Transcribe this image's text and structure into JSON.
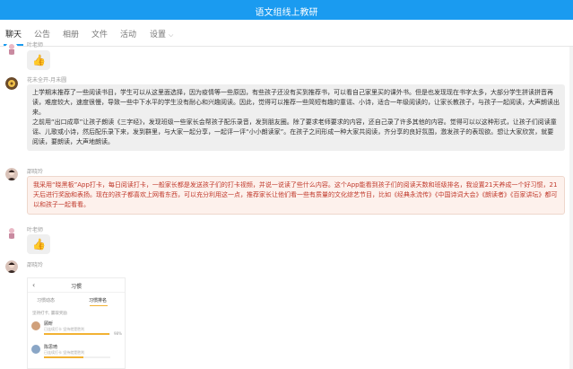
{
  "window": {
    "title": "语文组线上教研"
  },
  "tabs": [
    {
      "label": "聊天"
    },
    {
      "label": "公告"
    },
    {
      "label": "相册"
    },
    {
      "label": "文件"
    },
    {
      "label": "活动"
    },
    {
      "label": "设置"
    }
  ],
  "messages": [
    {
      "sender": "叶老师",
      "type": "emoji",
      "emoji": "👍"
    },
    {
      "sender": "花未全开-月未圆",
      "type": "text",
      "lines": [
        "上学期末推荐了一些阅读书目，学生可以从这里面选择，因为疫情等一些原因，有些孩子还没有买到推荐书，可以看自己家里买的课外书。但是也发现现在书字太多，大部分学生拼读拼音再读，难度较大，速度很慢，导致一些中下水平的学生没有耐心和兴趣阅读。因此，觉得可以推荐一些简短有趣的童谣、小诗，适合一年级阅读的，让家长教孩子，与孩子一起阅读，大声朗读出来。",
        "之前用“出口成章”让孩子朗读《三字经》，发现班级一些家长会帮孩子配乐录音，发到朋友圈。除了要求老师要求的内容，还自己录了许多其他的内容。觉得可以以这种形式，让孩子们阅读童谣、儿歌或小诗，然后配乐录下来，发到群里，与大家一起分享，一起评一评“小小朗读家”。在孩子之间形成一种大家共阅读，齐分享的良好氛围，激发孩子的表现欲。想让大家欣赏，就要阅读，要朗读，大声地朗读。"
      ]
    },
    {
      "sender": "邵晓玲",
      "type": "text",
      "lines": [
        "我采用“晓黑板”App打卡，每日阅读打卡，一般家长都是发送孩子们的打卡视频，并说一说读了些什么内容。这个App能看到孩子们的阅读天数和班级排名，我设置21天养成一个好习惯，21天后进行奖励和表扬。现在的孩子都喜欢上网看东西，可以充分利用这一点，推荐家长让他们看一些有质量的文化综艺节目，比如《经典永流传》《中国诗词大会》《朗读者》《百家讲坛》都可以和孩子一起看看。"
      ]
    },
    {
      "sender": "叶老师",
      "type": "emoji",
      "emoji": "👍"
    },
    {
      "sender": "邵晓玲",
      "type": "image",
      "phone": {
        "back": "‹",
        "title": "习惯",
        "tabs": [
          "习惯动态",
          "习惯排名"
        ],
        "tip": "坚持打卡, 赢取奖励",
        "rows": [
          {
            "name": "顾昕",
            "sub": "已连续打卡 坚持就是胜利",
            "progress": 0.98,
            "pct": "98%"
          },
          {
            "name": "陈思琦",
            "sub": "已连续打卡 坚持就是胜利",
            "progress": 0.6,
            "pct": ""
          }
        ]
      }
    }
  ],
  "colors": {
    "accent": "#1a9bf0",
    "highlight_text": "#c0392b"
  }
}
